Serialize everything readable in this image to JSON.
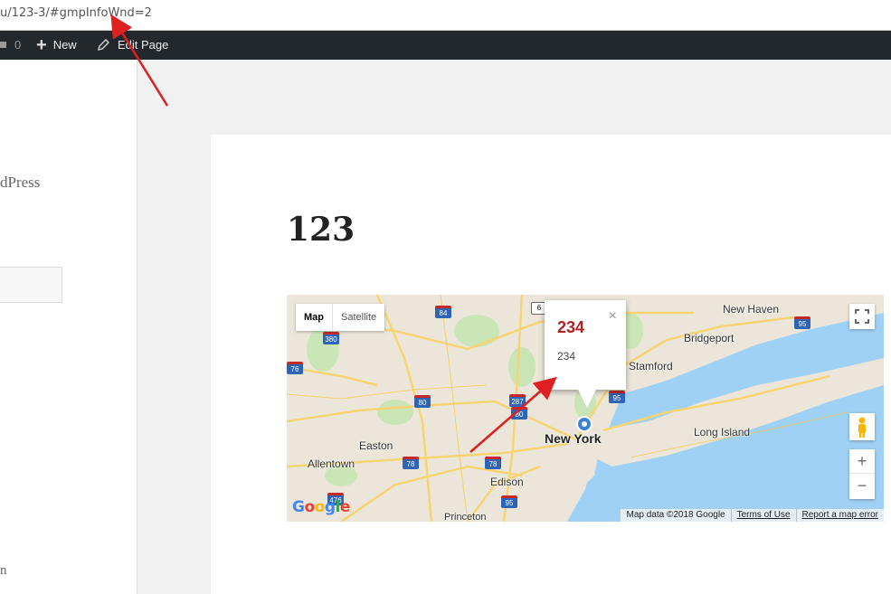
{
  "browser": {
    "url": "u/123-3/#gmpInfoWnd=2"
  },
  "adminbar": {
    "comments_count": "0",
    "new_label": "New",
    "edit_label": "Edit Page"
  },
  "sidebar": {
    "blog_fragment": "dPress",
    "bottom_fragment": "n"
  },
  "page": {
    "title": "123"
  },
  "map": {
    "type_map": "Map",
    "type_satellite": "Satellite",
    "info_title": "234",
    "info_body": "234",
    "close_glyph": "×",
    "zoom_in": "+",
    "zoom_out": "−",
    "fullscreen_glyph": "⛶",
    "attribution": {
      "data": "Map data ©2018 Google",
      "terms": "Terms of Use",
      "report": "Report a map error"
    },
    "places": {
      "new_york": "New York",
      "new_haven": "New Haven",
      "bridgeport": "Bridgeport",
      "stamford": "Stamford",
      "long_island": "Long Island",
      "easton": "Easton",
      "allentown": "Allentown",
      "edison": "Edison",
      "princeton": "Princeton"
    },
    "shields": {
      "i84": "84",
      "r6": "6",
      "i95a": "95",
      "i380": "380",
      "i287": "287",
      "i80a": "80",
      "i80b": "80",
      "i95b": "95",
      "i78a": "78",
      "i78b": "78",
      "i476": "476",
      "i95c": "95",
      "i76": "76"
    },
    "colors": {
      "water": "#9fd0f5",
      "land": "#ebe6d9",
      "park": "#c6e5b3",
      "road": "#f7d472"
    }
  },
  "annotations": {
    "arrow_color": "#e02020"
  }
}
